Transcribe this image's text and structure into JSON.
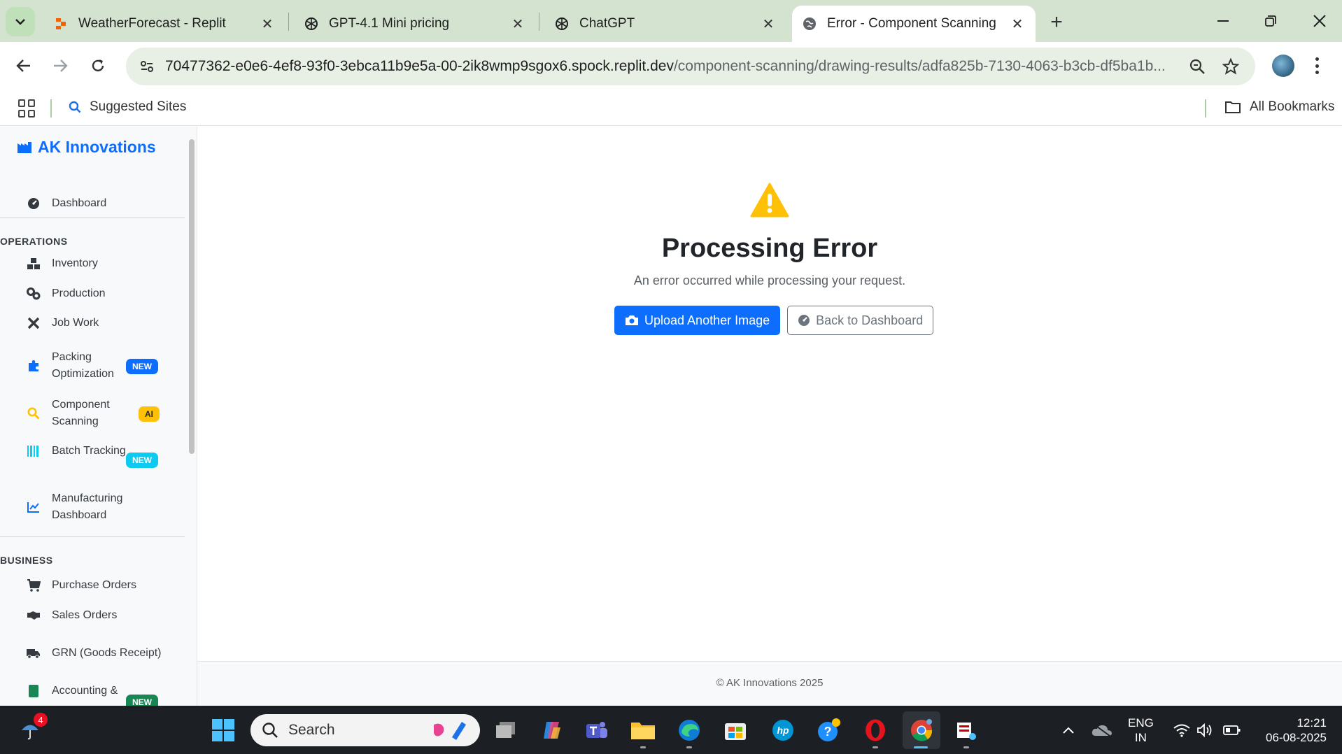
{
  "browser": {
    "tabs": [
      {
        "title": "WeatherForecast - Replit",
        "favicon": "replit-icon"
      },
      {
        "title": "GPT-4.1 Mini pricing",
        "favicon": "openai-icon"
      },
      {
        "title": "ChatGPT",
        "favicon": "openai-icon"
      },
      {
        "title": "Error - Component Scanning",
        "favicon": "globe-icon",
        "active": true
      }
    ],
    "url_host": "70477362-e0e6-4ef8-93f0-3ebca11b9e5a-00-2ik8wmp9sgox6.spock.replit.dev",
    "url_path": "/component-scanning/drawing-results/adfa825b-7130-4063-b3cb-df5ba1b...",
    "bookmarks": {
      "suggested": "Suggested Sites",
      "all": "All Bookmarks"
    }
  },
  "sidebar": {
    "brand": "AK Innovations",
    "dashboard": "Dashboard",
    "sections": {
      "operations": "OPERATIONS",
      "business": "BUSINESS"
    },
    "items": {
      "inventory": "Inventory",
      "production": "Production",
      "job_work": "Job Work",
      "packing": "Packing Optimization",
      "component_scanning": "Component Scanning",
      "batch_tracking": "Batch Tracking",
      "manufacturing_dashboard": "Manufacturing Dashboard",
      "purchase_orders": "Purchase Orders",
      "sales_orders": "Sales Orders",
      "grn": "GRN (Goods Receipt)",
      "accounting": "Accounting &"
    },
    "badges": {
      "packing": "NEW",
      "component_scanning": "AI",
      "batch_tracking": "NEW",
      "accounting": "NEW"
    }
  },
  "main": {
    "error_title": "Processing Error",
    "error_message": "An error occurred while processing your request.",
    "upload_button": "Upload Another Image",
    "back_button": "Back to Dashboard",
    "footer": "© AK Innovations 2025"
  },
  "taskbar": {
    "search_placeholder": "Search",
    "notification_count": "4",
    "language": "ENG",
    "region": "IN",
    "time": "12:21",
    "date": "06-08-2025"
  },
  "colors": {
    "primary": "#0d6efd",
    "warning": "#ffc107",
    "chrome_tabstrip": "#d3e3d0",
    "taskbar": "#1c1f24"
  }
}
